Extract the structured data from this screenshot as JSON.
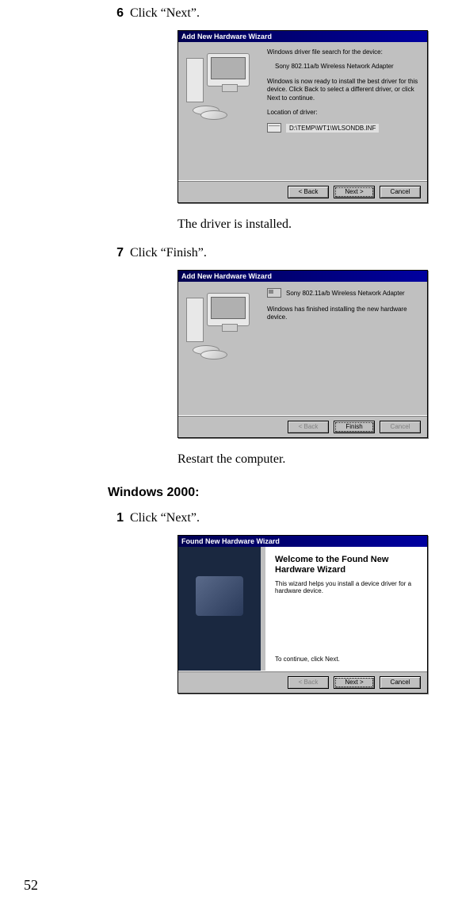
{
  "page_number": "52",
  "steps": [
    {
      "num": "6",
      "text": "Click “Next”."
    },
    {
      "num": "7",
      "text": "Click “Finish”."
    },
    {
      "num": "1",
      "text": "Click “Next”."
    }
  ],
  "results": [
    "The driver is installed.",
    "Restart the computer."
  ],
  "heading_win2000": "Windows 2000:",
  "dialog1": {
    "title": "Add New Hardware Wizard",
    "line1": "Windows driver file search for the device:",
    "device": "Sony 802.11a/b Wireless Network Adapter",
    "line2": "Windows is now ready to install the best driver for this device. Click Back to select a different driver, or click Next to continue.",
    "loc_label": "Location of driver:",
    "path": "D:\\TEMP\\WT1\\WLSONDB.INF",
    "back": "< Back",
    "next": "Next >",
    "cancel": "Cancel"
  },
  "dialog2": {
    "title": "Add New Hardware Wizard",
    "device": "Sony 802.11a/b Wireless Network Adapter",
    "line1": "Windows has finished installing the new hardware device.",
    "back": "< Back",
    "finish": "Finish",
    "cancel": "Cancel"
  },
  "dialog3": {
    "title": "Found New Hardware Wizard",
    "welcome": "Welcome to the Found New Hardware Wizard",
    "line1": "This wizard helps you install a device driver for a hardware device.",
    "line2": "To continue, click Next.",
    "back": "< Back",
    "next": "Next >",
    "cancel": "Cancel"
  }
}
